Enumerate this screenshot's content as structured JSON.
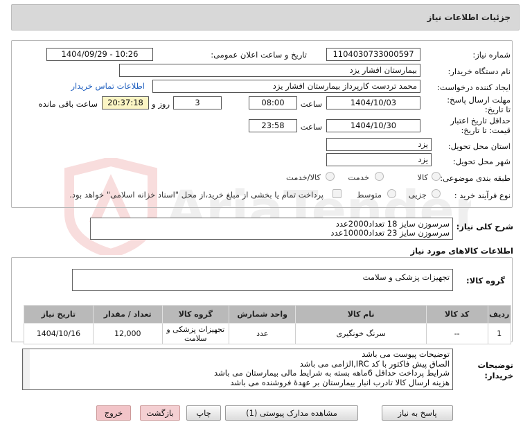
{
  "header": {
    "title": "جزئیات اطلاعات نیاز"
  },
  "form": {
    "need_number_label": "شماره نیاز:",
    "need_number": "1104030733000597",
    "announce_label": "تاریخ و ساعت اعلان عمومی:",
    "announce_value": "1404/09/29 - 10:26",
    "buyer_org_label": "نام دستگاه خریدار:",
    "buyer_org": "بیمارستان افشار یزد",
    "creator_label": "ایجاد کننده درخواست:",
    "creator": "محمد تردست کارپرداز بیمارستان افشار یزد",
    "contact_link": "اطلاعات تماس خریدار",
    "reply_deadline_label": "مهلت ارسال پاسخ: تا تاریخ:",
    "reply_date": "1404/10/03",
    "time_label": "ساعت",
    "reply_time": "08:00",
    "days_value": "3",
    "days_label": "روز و",
    "remaining_time": "20:37:18",
    "remaining_label": "ساعت باقی مانده",
    "validity_label": "حداقل تاریخ اعتبار قیمت: تا تاریخ:",
    "validity_date": "1404/10/30",
    "validity_time": "23:58",
    "province_label": "استان محل تحویل:",
    "province": "یزد",
    "city_label": "شهر محل تحویل:",
    "city": "یزد",
    "category_label": "طبقه بندی موضوعی:",
    "category_options": [
      "کالا",
      "خدمت",
      "کالا/خدمت"
    ],
    "process_label": "نوع فرآیند خرید :",
    "process_options": [
      "جزیی",
      "متوسط"
    ],
    "payment_note": "پرداخت تمام یا بخشی از مبلغ خرید،از محل \"اسناد خزانه اسلامی\" خواهد بود."
  },
  "description": {
    "label": "شرح کلی نیاز:",
    "lines": [
      "سرسوزن سایز 18 تعداد2000عدد",
      "سرسوزن سایز 23 تعداد10000عدد"
    ]
  },
  "goods": {
    "section_title": "اطلاعات کالاهای مورد نیاز",
    "group_label": "گروه کالا:",
    "group_value": "تجهیزات پزشکی و سلامت",
    "columns": [
      "ردیف",
      "کد کالا",
      "نام کالا",
      "واحد شمارش",
      "گروه کالا",
      "تعداد / مقدار",
      "تاریخ نیاز"
    ],
    "rows": [
      {
        "row": "1",
        "code": "--",
        "name": "سرنگ خونگیری",
        "unit": "عدد",
        "group": "تجهیزات پزشکی و سلامت",
        "qty": "12,000",
        "date": "1404/10/16"
      }
    ]
  },
  "buyer_notes": {
    "label": "توضیحات خریدار:",
    "lines": [
      "توضیحات پیوست می باشد",
      "الصاق پیش فاکتور با کد  IRC,الزامی می باشد",
      "شرایط پرداخت حداقل 6ماهه بسته به شرایط مالی بیمارستان می باشد",
      "هزینه ارسال کالا تادرب انبار بیمارستان بر عهدهٔ فروشنده می باشد"
    ]
  },
  "buttons": {
    "reply": "پاسخ به نیاز",
    "attachments": "مشاهده مدارک پیوستی (1)",
    "print": "چاپ",
    "back": "بازگشت",
    "exit": "خروج"
  },
  "watermark": {
    "text": "AriaTender.neT"
  }
}
